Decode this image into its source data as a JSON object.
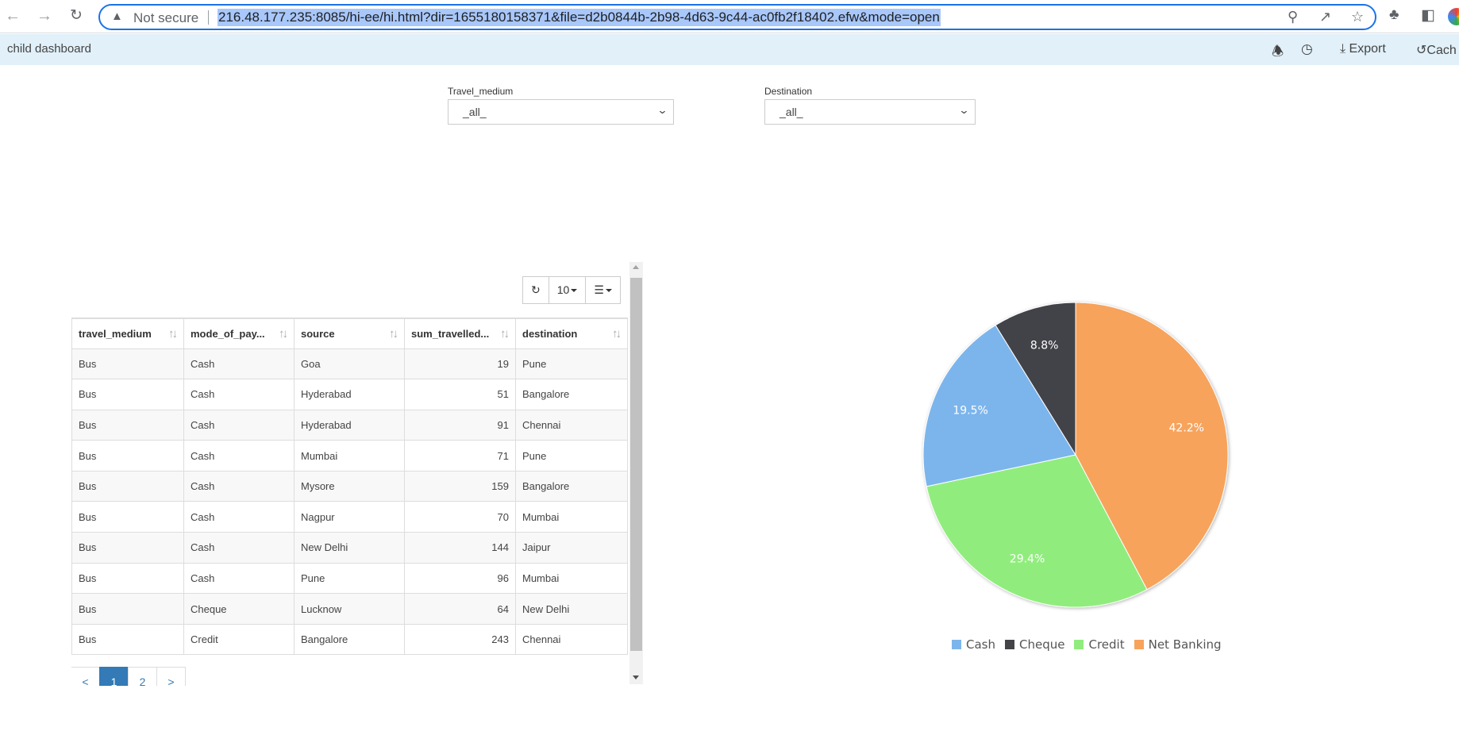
{
  "browser": {
    "security_label": "Not secure",
    "url": "216.48.177.235:8085/hi-ee/hi.html?dir=1655180158371&file=d2b0844b-2b98-4d63-9c44-ac0fb2f18402.efw&mode=open"
  },
  "header": {
    "title": "child dashboard",
    "export_label": "Export",
    "cache_label": "Cach"
  },
  "filters": [
    {
      "label": "Travel_medium",
      "value": "_all_"
    },
    {
      "label": "Destination",
      "value": "_all_"
    }
  ],
  "table": {
    "page_size": "10",
    "columns": [
      "travel_medium",
      "mode_of_pay...",
      "source",
      "sum_travelled...",
      "destination"
    ],
    "rows": [
      [
        "Bus",
        "Cash",
        "Goa",
        "19",
        "Pune"
      ],
      [
        "Bus",
        "Cash",
        "Hyderabad",
        "51",
        "Bangalore"
      ],
      [
        "Bus",
        "Cash",
        "Hyderabad",
        "91",
        "Chennai"
      ],
      [
        "Bus",
        "Cash",
        "Mumbai",
        "71",
        "Pune"
      ],
      [
        "Bus",
        "Cash",
        "Mysore",
        "159",
        "Bangalore"
      ],
      [
        "Bus",
        "Cash",
        "Nagpur",
        "70",
        "Mumbai"
      ],
      [
        "Bus",
        "Cash",
        "New Delhi",
        "144",
        "Jaipur"
      ],
      [
        "Bus",
        "Cash",
        "Pune",
        "96",
        "Mumbai"
      ],
      [
        "Bus",
        "Cheque",
        "Lucknow",
        "64",
        "New Delhi"
      ],
      [
        "Bus",
        "Credit",
        "Bangalore",
        "243",
        "Chennai"
      ]
    ],
    "pagination": {
      "prev": "<",
      "pages": [
        "1",
        "2"
      ],
      "active": "1",
      "next": ">"
    }
  },
  "chart_data": {
    "type": "pie",
    "title": "",
    "categories": [
      "Cash",
      "Cheque",
      "Credit",
      "Net Banking"
    ],
    "values": [
      19.5,
      8.8,
      29.4,
      42.2
    ],
    "labels": [
      "19.5%",
      "8.8%",
      "29.4%",
      "42.2%"
    ],
    "colors": [
      "#7cb5ec",
      "#434348",
      "#90ed7d",
      "#f7a35c"
    ],
    "legend": "bottom"
  }
}
